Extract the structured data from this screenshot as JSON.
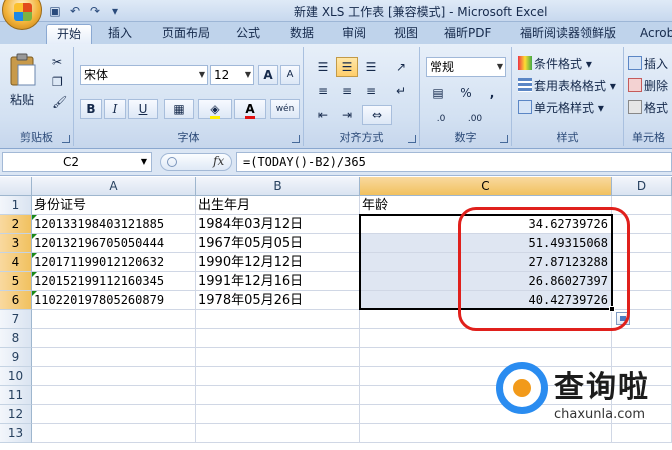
{
  "window": {
    "title": "新建 XLS 工作表 [兼容模式] - Microsoft Excel"
  },
  "tabs": [
    "开始",
    "插入",
    "页面布局",
    "公式",
    "数据",
    "审阅",
    "视图",
    "福昕PDF",
    "福昕阅读器领鲜版",
    "Acrob"
  ],
  "ribbon": {
    "clipboard": {
      "label": "剪贴板",
      "paste": "粘贴"
    },
    "font": {
      "label": "字体",
      "font_name": "宋体",
      "font_size": "12",
      "bold": "B",
      "italic": "I",
      "underline": "U",
      "grow": "A",
      "shrink": "A",
      "font_color": "A",
      "phonetic": "wén"
    },
    "alignment": {
      "label": "对齐方式"
    },
    "number": {
      "label": "数字",
      "format": "常规",
      "percent": "%",
      "comma": ",",
      "inc_dec": ".0",
      "dec_dec": ".00"
    },
    "styles": {
      "label": "样式",
      "conditional": "条件格式",
      "table": "套用表格格式",
      "cell": "单元格样式"
    },
    "cells": {
      "label": "单元格",
      "insert": "插入",
      "delete": "删除",
      "format": "格式"
    }
  },
  "formula_bar": {
    "name_box": "C2",
    "fx": "fx",
    "formula": "=(TODAY()-B2)/365"
  },
  "columns": [
    "A",
    "B",
    "C",
    "D"
  ],
  "rows": [
    "1",
    "2",
    "3",
    "4",
    "5",
    "6",
    "7",
    "8",
    "9",
    "10",
    "11",
    "12",
    "13"
  ],
  "cells": {
    "header": [
      "身份证号",
      "出生年月",
      "年龄"
    ],
    "data": [
      [
        "120133198403121885",
        "1984年03月12日",
        "34.62739726"
      ],
      [
        "120132196705050444",
        "1967年05月05日",
        "51.49315068"
      ],
      [
        "120171199012120632",
        "1990年12月12日",
        "27.87123288"
      ],
      [
        "120152199112160345",
        "1991年12月16日",
        "26.86027397"
      ],
      [
        "110220197805260879",
        "1978年05月26日",
        "40.42739726"
      ]
    ]
  },
  "watermark": {
    "cn": "查询啦",
    "en": "chaxunla.com"
  },
  "colors": {
    "selection_border": "#000000",
    "annotation": "#e0201c",
    "header_selected": "#f1c15f"
  }
}
